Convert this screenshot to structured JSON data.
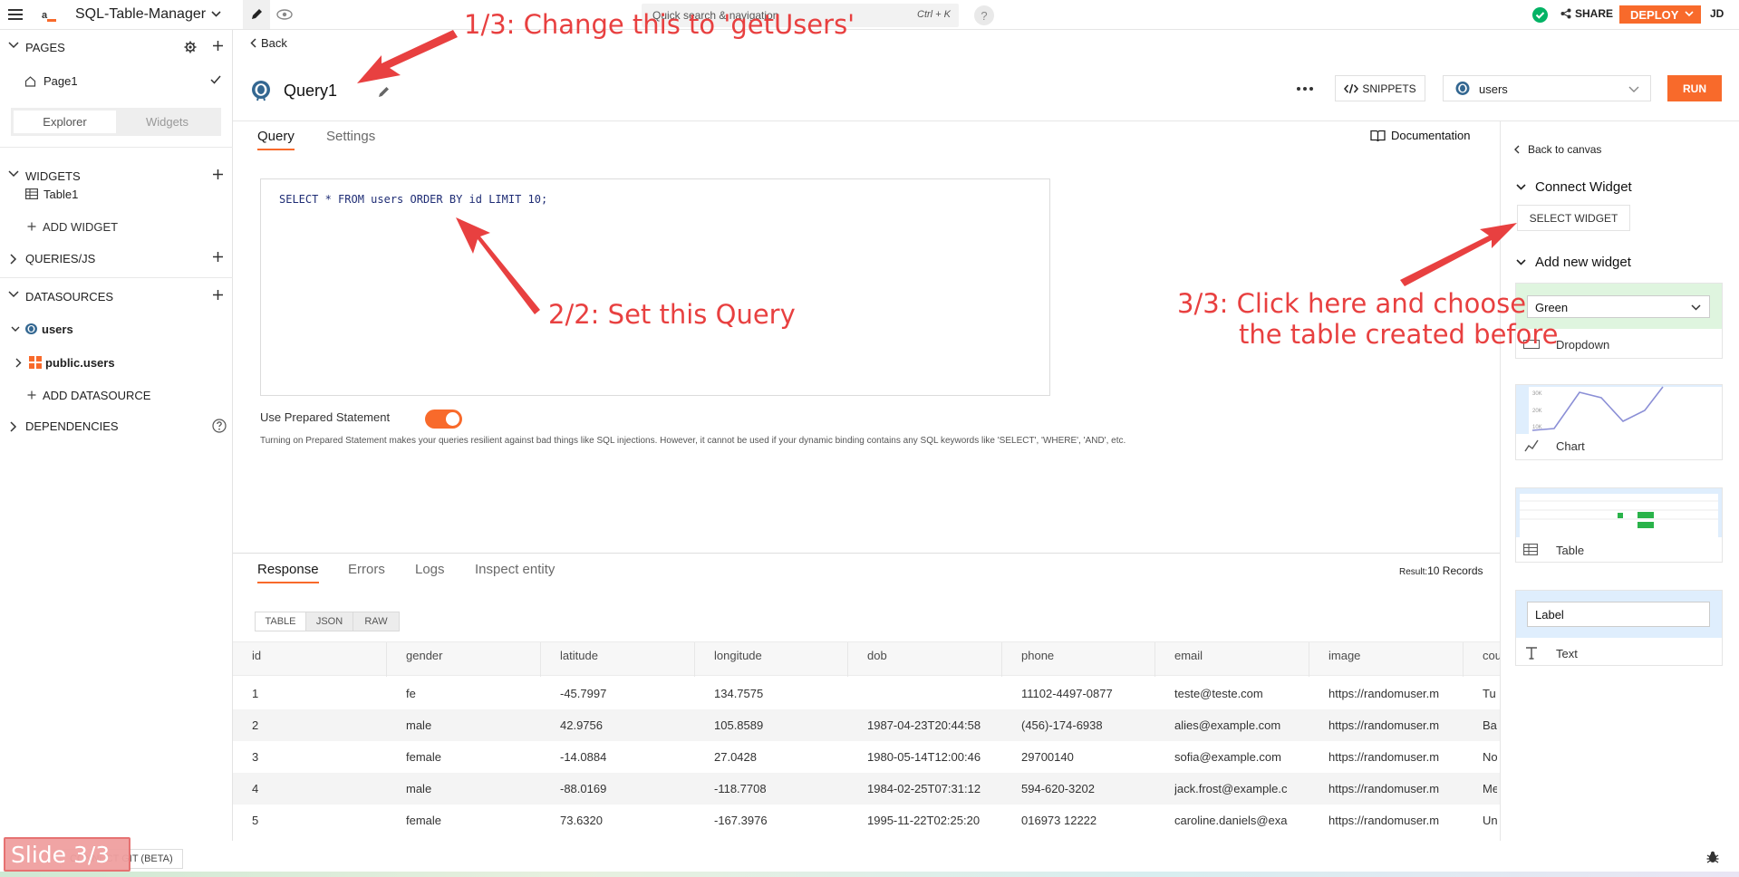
{
  "app": {
    "name": "SQL-Table-Manager",
    "logo": "a_",
    "user_initials": "JD"
  },
  "topbar": {
    "search_placeholder": "Quick search & navigation",
    "search_shortcut": "Ctrl + K",
    "help": "?",
    "share": "SHARE",
    "deploy": "DEPLOY"
  },
  "sidebar": {
    "pages_title": "PAGES",
    "page1": "Page1",
    "explorer_tab": "Explorer",
    "widgets_tab": "Widgets",
    "widgets_title": "WIDGETS",
    "table1": "Table1",
    "add_widget": "ADD WIDGET",
    "queries_title": "QUERIES/JS",
    "datasources_title": "DATASOURCES",
    "ds_users": "users",
    "public_users": "public.users",
    "add_datasource": "ADD DATASOURCE",
    "dependencies_title": "DEPENDENCIES"
  },
  "editor": {
    "back": "Back",
    "query_name": "Query1",
    "snippets": "SNIPPETS",
    "datasource_select": "users",
    "run": "RUN",
    "tab_query": "Query",
    "tab_settings": "Settings",
    "documentation": "Documentation",
    "sql": "SELECT * FROM users ORDER BY id LIMIT 10;",
    "prepared_label": "Use Prepared Statement",
    "prepared_on": true,
    "prepared_help": "Turning on Prepared Statement makes your queries resilient against bad things like SQL injections. However, it cannot be used if your dynamic binding contains any SQL keywords like 'SELECT', 'WHERE', 'AND', etc."
  },
  "response": {
    "tabs": [
      "Response",
      "Errors",
      "Logs",
      "Inspect entity"
    ],
    "result_label": "Result:",
    "result_value": "10 Records",
    "view_tabs": [
      "TABLE",
      "JSON",
      "RAW"
    ],
    "columns": [
      "id",
      "gender",
      "latitude",
      "longitude",
      "dob",
      "phone",
      "email",
      "image",
      "cou"
    ],
    "rows": [
      [
        "1",
        "fe",
        "-45.7997",
        "134.7575",
        "",
        "11102-4497-0877",
        "teste@teste.com",
        "https://randomuser.m",
        "Tu"
      ],
      [
        "2",
        "male",
        "42.9756",
        "105.8589",
        "1987-04-23T20:44:58",
        "(456)-174-6938",
        "alies@example.com",
        "https://randomuser.m",
        "Ba"
      ],
      [
        "3",
        "female",
        "-14.0884",
        "27.0428",
        "1980-05-14T12:00:46",
        "29700140",
        "sofia@example.com",
        "https://randomuser.m",
        "No"
      ],
      [
        "4",
        "male",
        "-88.0169",
        "-118.7708",
        "1984-02-25T07:31:12",
        "594-620-3202",
        "jack.frost@example.c",
        "https://randomuser.m",
        "Me"
      ],
      [
        "5",
        "female",
        "73.6320",
        "-167.3976",
        "1995-11-22T02:25:20",
        "016973 12222",
        "caroline.daniels@exa",
        "https://randomuser.m",
        "Un"
      ]
    ]
  },
  "rightpanel": {
    "back_to_canvas": "Back to canvas",
    "connect_widget": "Connect Widget",
    "select_widget": "SELECT WIDGET",
    "add_new_widget": "Add new widget",
    "dropdown_value": "Green",
    "dropdown_label": "Dropdown",
    "chart_label": "Chart",
    "table_label": "Table",
    "text_thumb": "Label",
    "text_label": "Text"
  },
  "annotations": {
    "a1": "1/3: Change this to 'getUsers'",
    "a2": "2/2: Set this Query",
    "a3_line1": "3/3: Click here and choose",
    "a3_line2": "the table created before"
  },
  "footer": {
    "slide": "Slide 3/3",
    "connect": "CONNECT GIT (BETA)"
  },
  "colors": {
    "accent": "#f86a2b",
    "annotation": "#e84040",
    "success": "#03b365",
    "link": "#2e4b9c"
  }
}
